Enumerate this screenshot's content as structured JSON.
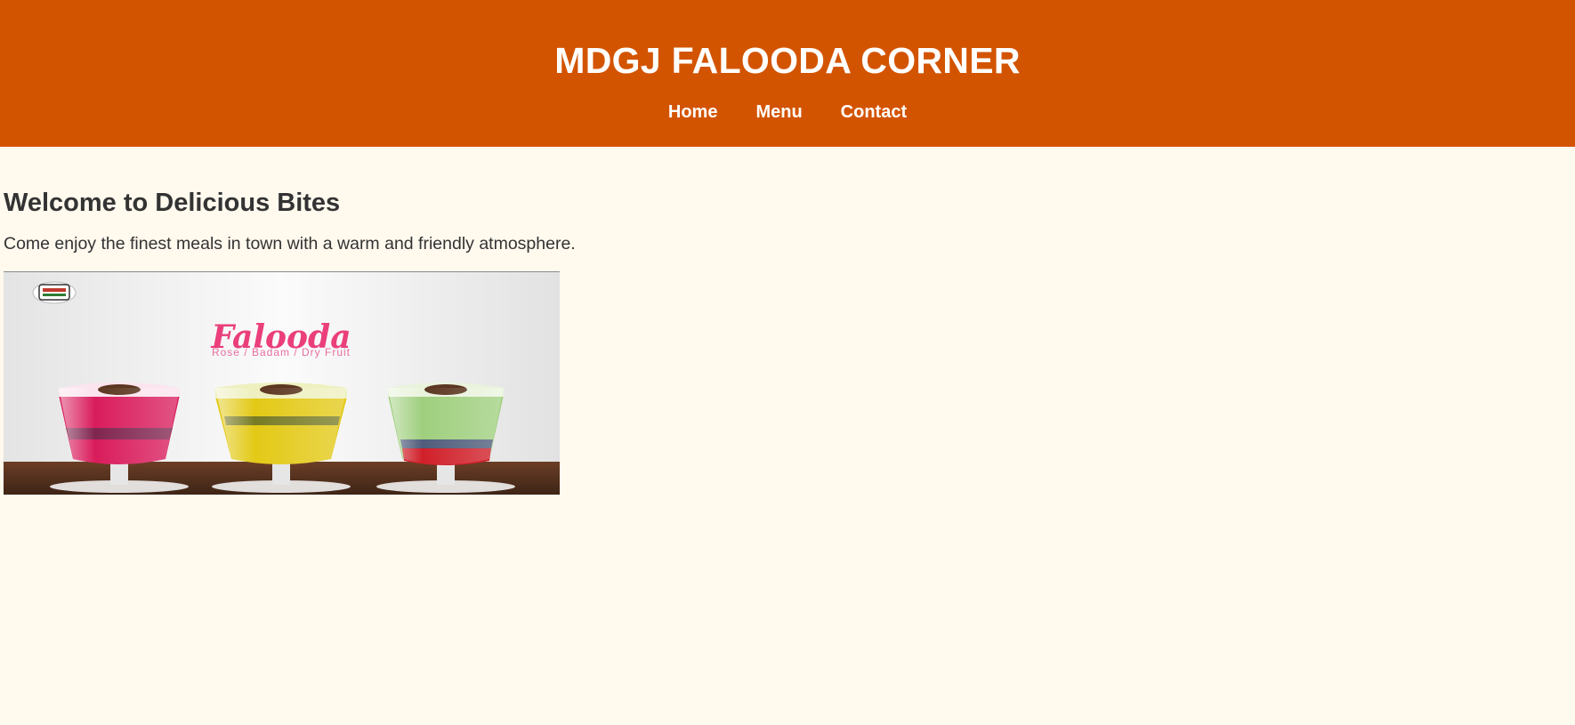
{
  "header": {
    "title": "MDGJ FALOODA CORNER",
    "nav": [
      {
        "label": "Home"
      },
      {
        "label": "Menu"
      },
      {
        "label": "Contact"
      }
    ],
    "background_color": "#d35400"
  },
  "main": {
    "heading": "Welcome to Delicious Bites",
    "intro": "Come enjoy the finest meals in town with a warm and friendly atmosphere.",
    "hero_image": {
      "title": "Falooda",
      "subtitle": "Rose  / Badam / Dry Fruit",
      "glasses": [
        {
          "name": "Rose",
          "color": "#e0245e"
        },
        {
          "name": "Badam",
          "color": "#e3c916"
        },
        {
          "name": "Dry Fruit",
          "color": "#9fcf7e"
        }
      ]
    }
  },
  "page": {
    "background_color": "#fff9ee"
  }
}
